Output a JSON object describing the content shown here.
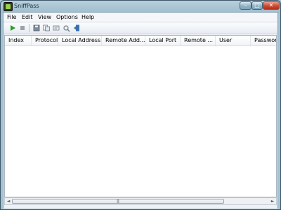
{
  "window": {
    "title": "SniffPass",
    "controls": {
      "minimize": "–",
      "maximize": "□",
      "close": "✕"
    }
  },
  "menu": {
    "items": [
      {
        "label": "File"
      },
      {
        "label": "Edit"
      },
      {
        "label": "View"
      },
      {
        "label": "Options"
      },
      {
        "label": "Help"
      }
    ]
  },
  "toolbar": {
    "icons": [
      "start-capture-icon",
      "stop-capture-icon",
      "save-icon",
      "copy-icon",
      "properties-icon",
      "options-icon",
      "exit-icon"
    ]
  },
  "table": {
    "columns": [
      {
        "label": "Index"
      },
      {
        "label": "Protocol"
      },
      {
        "label": "Local Address"
      },
      {
        "label": "Remote Add..."
      },
      {
        "label": "Local Port"
      },
      {
        "label": "Remote ..."
      },
      {
        "label": "User"
      },
      {
        "label": "Password"
      }
    ],
    "rows": []
  },
  "scrollbar": {
    "left_arrow": "◄",
    "right_arrow": "►",
    "grip": "|||"
  },
  "colors": {
    "title_bar": "#b7d0dc",
    "close_button": "#c94a33",
    "start_green": "#2e9b2e"
  }
}
